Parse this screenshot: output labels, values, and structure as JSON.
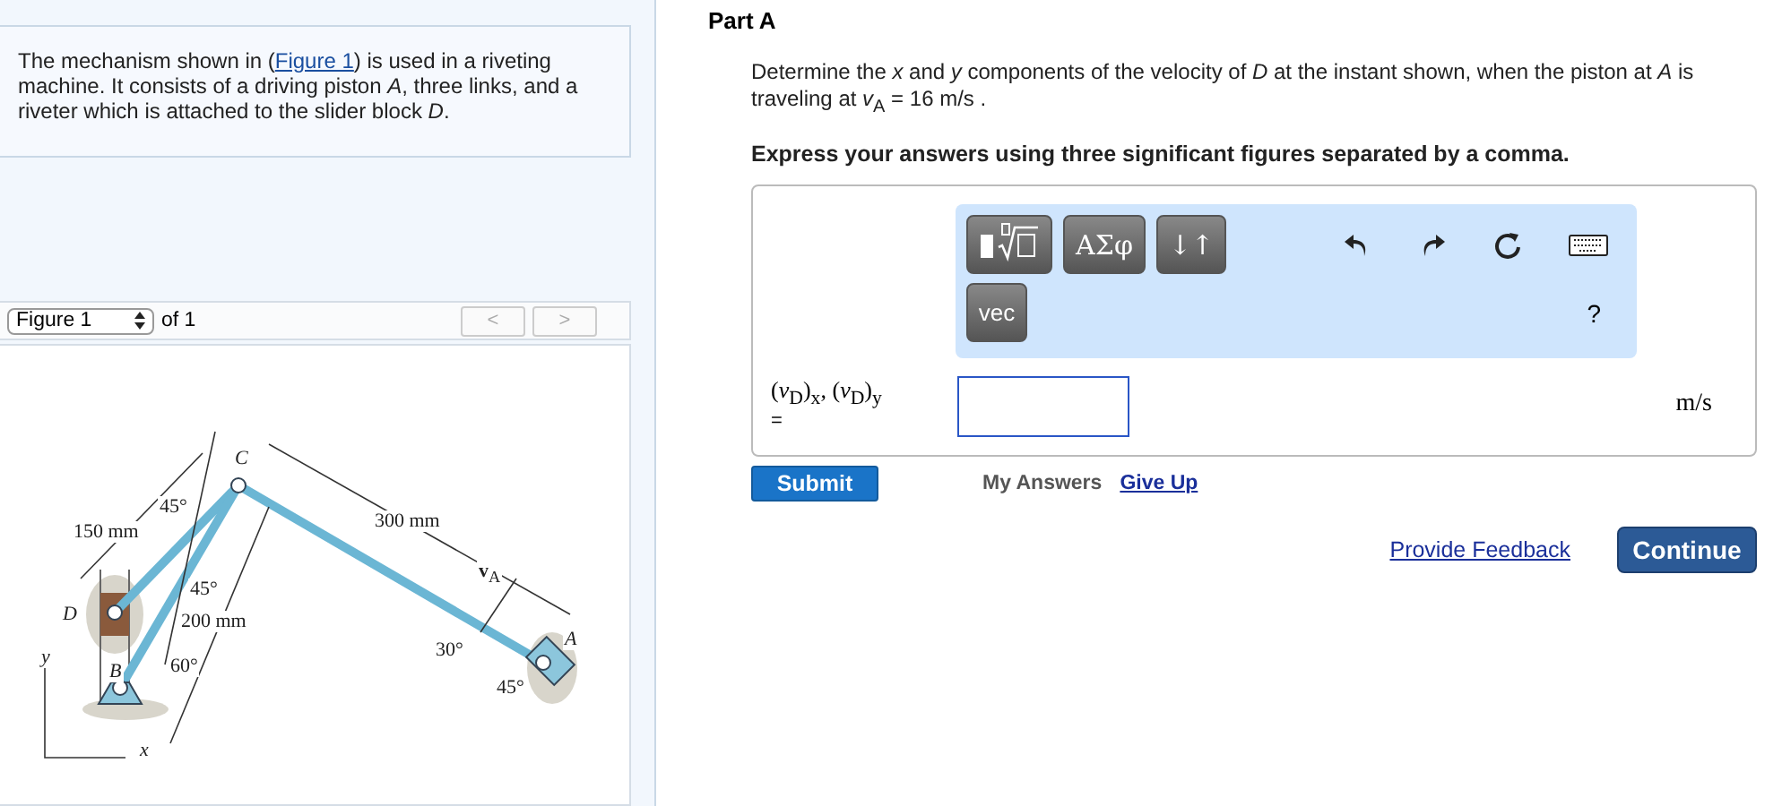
{
  "problem": {
    "before": "The mechanism shown in (",
    "link": "Figure 1",
    "after": ") is used in a riveting machine. It consists of a driving piston *A*, three links, and a riveter which is attached to the slider block *D*."
  },
  "figure_nav": {
    "select": "Figure 1",
    "of": "of 1",
    "prev": "<",
    "next": ">",
    "prev_disabled": true,
    "next_disabled": true
  },
  "figure": {
    "labels": [
      {
        "text": "*C*",
        "kind": "point"
      },
      {
        "text": "45°",
        "kind": "dim"
      },
      {
        "text": "150 mm",
        "kind": "dim"
      },
      {
        "text": "300 mm",
        "kind": "dim"
      },
      {
        "text": "**v**$_{A}$",
        "kind": "dim"
      },
      {
        "text": "45°",
        "kind": "dim"
      },
      {
        "text": "*D*",
        "kind": "point"
      },
      {
        "text": "200 mm",
        "kind": "dim"
      },
      {
        "text": "30°",
        "kind": "dim"
      },
      {
        "text": "*A*",
        "kind": "point"
      },
      {
        "text": "*y*",
        "kind": "point"
      },
      {
        "text": "*B*",
        "kind": "point"
      },
      {
        "text": "60°",
        "kind": "dim"
      },
      {
        "text": "45°",
        "kind": "dim"
      },
      {
        "text": "*x*",
        "kind": "point"
      }
    ]
  },
  "part": {
    "title": "Part A",
    "question": "Determine the *x* and *y* components of the velocity of *D* at the instant shown, when the piston at *A* is traveling at *v*$_{A}$ = 16  m/s .",
    "instruction": "Express your answers using three significant figures separated by a comma."
  },
  "toolbar": {
    "buttons": [
      {
        "kind": "template"
      },
      {
        "kind": "text",
        "label": "ΑΣφ"
      },
      {
        "kind": "text",
        "label": "↓↑"
      }
    ],
    "vec": "vec",
    "help": "?"
  },
  "answer": {
    "label": "(*v*$_{D}$)$_{x}$, (*v*$_{D}$)$_{y}$",
    "equals": "=",
    "unit": "m/s"
  },
  "actions": {
    "submit": "Submit",
    "my_answers": "My Answers",
    "give_up": "Give Up",
    "feedback": "Provide Feedback",
    "continue": "Continue"
  }
}
